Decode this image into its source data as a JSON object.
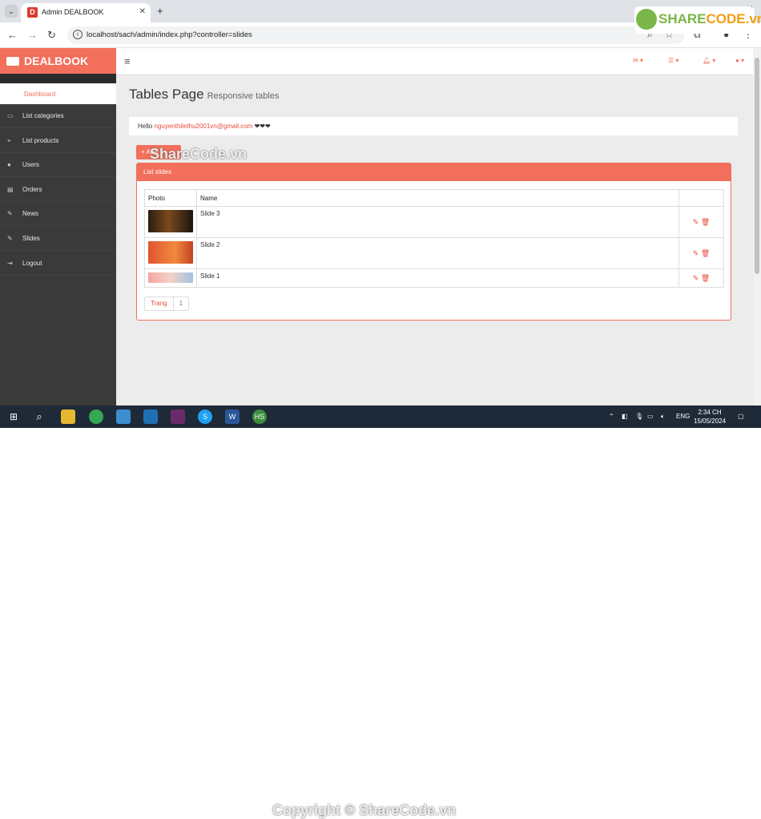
{
  "browser": {
    "tab_title": "Admin DEALBOOK",
    "tab_favicon": "D",
    "url": "localhost/sach/admin/index.php?controller=slides"
  },
  "app": {
    "brand": "DEALBOOK",
    "sidebar": {
      "active_item": "Dashboard",
      "items": [
        {
          "label": "List categories",
          "icon": "monitor-icon"
        },
        {
          "label": "List products",
          "icon": "sitemap-icon"
        },
        {
          "label": "Users",
          "icon": "user-icon"
        },
        {
          "label": "Orders",
          "icon": "table-icon"
        },
        {
          "label": "News",
          "icon": "edit-icon"
        },
        {
          "label": "Slides",
          "icon": "edit-icon"
        },
        {
          "label": "Logout",
          "icon": "logout-icon"
        }
      ]
    },
    "page_title": "Tables Page",
    "page_subtitle": "Responsive tables",
    "hello_prefix": "Hello",
    "hello_email": "nguyenthilethu2001vn@gmail.com",
    "hello_suffix": "❤❤❤",
    "add_button": "+ Add",
    "panel_title": "List slides",
    "table": {
      "headers": [
        "Photo",
        "Name",
        ""
      ],
      "rows": [
        {
          "name": "Slide 3"
        },
        {
          "name": "Slide 2"
        },
        {
          "name": "Slide 1"
        }
      ]
    },
    "pager": {
      "label": "Trang",
      "page": "1"
    }
  },
  "taskbar": {
    "lang": "ENG",
    "time": "2:34 CH",
    "date": "15/05/2024"
  },
  "watermark": {
    "logo_main": "SHARE",
    "logo_accent": "CODE.vn",
    "overlay_text": "ShareCode.vn",
    "footer_text": "Copyright © ShareCode.vn"
  },
  "colors": {
    "accent": "#f26f5b",
    "sidebar": "#3a3a3a"
  }
}
